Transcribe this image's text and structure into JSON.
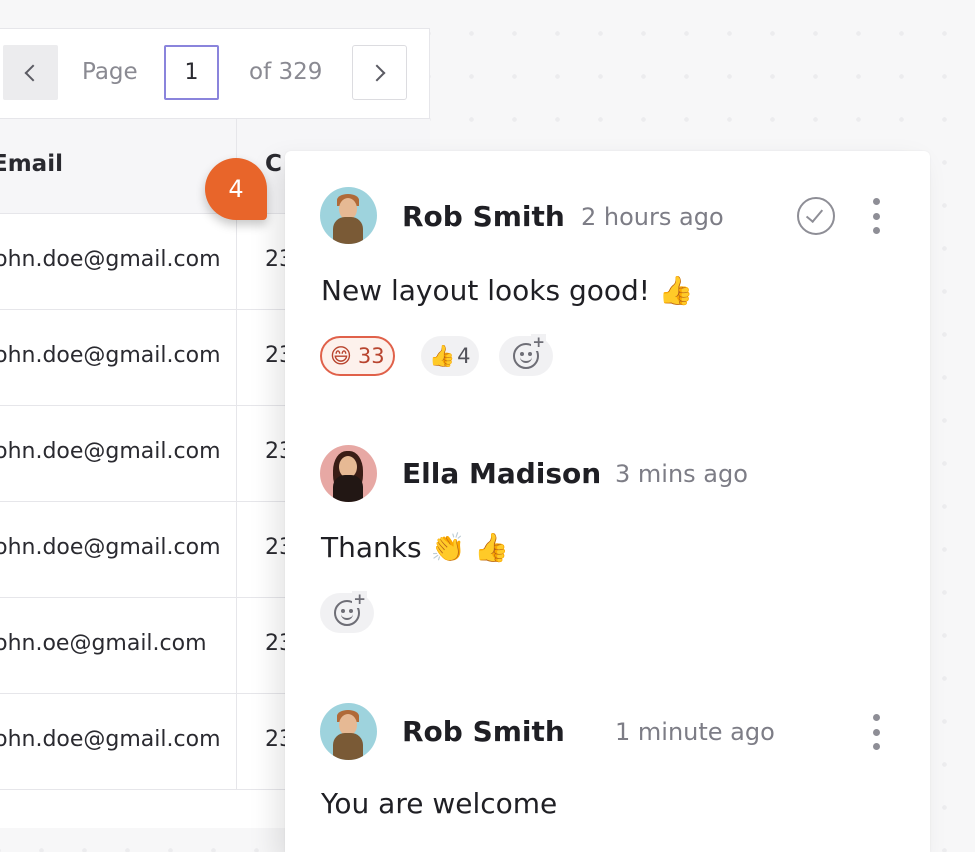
{
  "pagination": {
    "page_label": "Page",
    "current_page": "1",
    "of_total": "of 329"
  },
  "table": {
    "headers": {
      "email": "Email",
      "second": "C"
    },
    "rows": [
      {
        "email": "john.doe@gmail.com",
        "second": "23"
      },
      {
        "email": "john.doe@gmail.com",
        "second": "23"
      },
      {
        "email": "john.doe@gmail.com",
        "second": "23"
      },
      {
        "email": "john.doe@gmail.com",
        "second": "23"
      },
      {
        "email": "john.oe@gmail.com",
        "second": "23"
      },
      {
        "email": "john.doe@gmail.com",
        "second": "23"
      }
    ]
  },
  "marker": {
    "number": "4",
    "color": "#e8652a"
  },
  "comments": [
    {
      "author": "Rob Smith",
      "time": "2 hours ago",
      "text": "New layout looks good! 👍",
      "reactions": [
        {
          "emoji": "😄",
          "count": "33",
          "active": true
        },
        {
          "emoji": "👍",
          "count": "4",
          "active": false
        }
      ],
      "add_reaction_icon": "add-emoji-icon",
      "actions": [
        "resolve-check-icon",
        "more-vertical-icon"
      ]
    },
    {
      "author": "Ella Madison",
      "time": "3 mins ago",
      "text": "Thanks 👏 👍",
      "reactions": [],
      "add_reaction_icon": "add-emoji-icon"
    },
    {
      "author": "Rob Smith",
      "time": "1 minute ago",
      "text": "You are welcome",
      "actions": [
        "more-vertical-icon"
      ]
    }
  ]
}
